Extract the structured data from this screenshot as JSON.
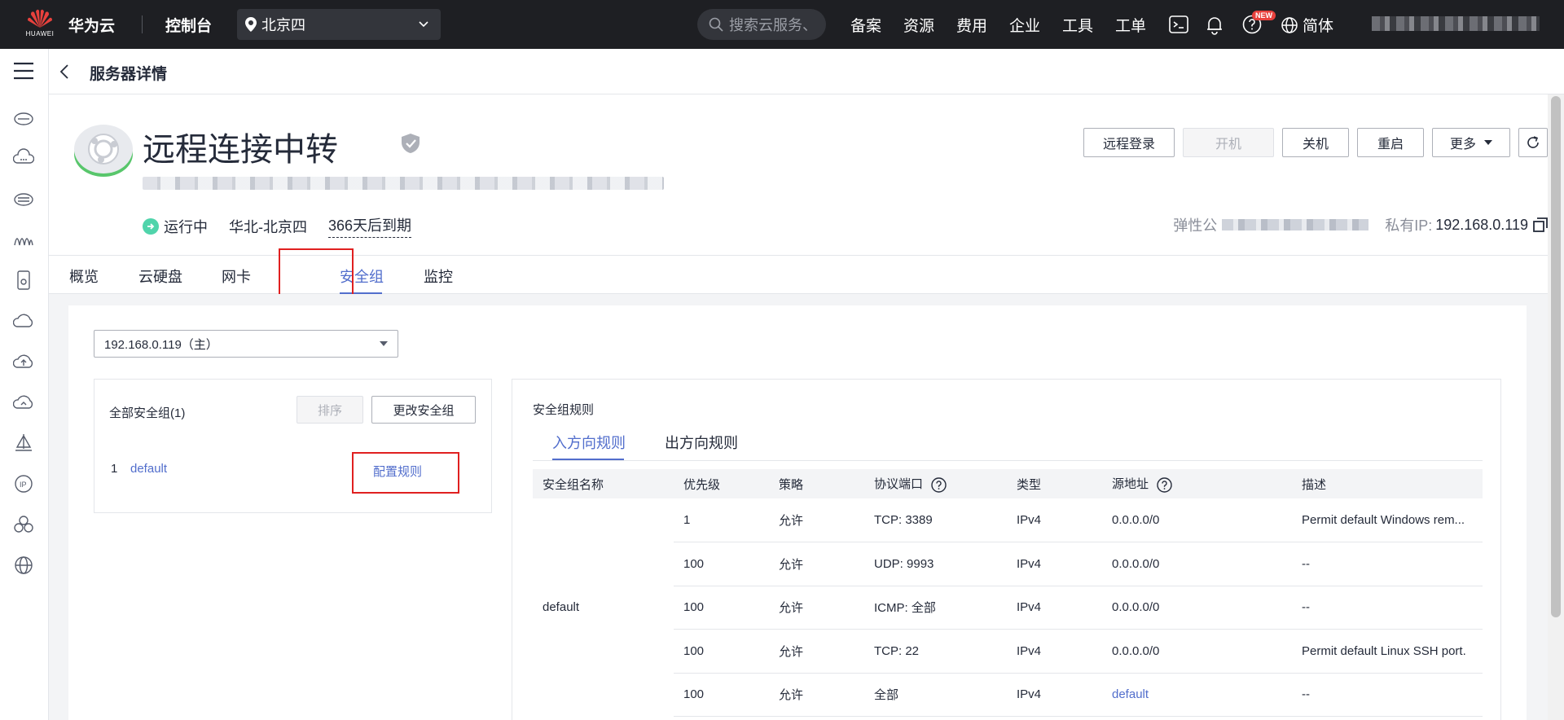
{
  "topbar": {
    "logo_text": "HUAWEI",
    "brand": "华为云",
    "console": "控制台",
    "region": "北京四",
    "search_placeholder": "搜索云服务、",
    "nav": [
      "备案",
      "资源",
      "费用",
      "企业",
      "工具",
      "工单"
    ],
    "new_badge": "NEW",
    "lang": "简体"
  },
  "header": {
    "title": "服务器详情"
  },
  "server": {
    "name": "远程连接中转",
    "status": "运行中",
    "region": "华北-北京四",
    "expiry": "366天后到期",
    "public_ip_label": "弹性公",
    "private_ip_label": "私有IP:",
    "private_ip": "192.168.0.119"
  },
  "actions": {
    "remote_login": "远程登录",
    "start": "开机",
    "stop": "关机",
    "restart": "重启",
    "more": "更多"
  },
  "tabs": [
    "概览",
    "云硬盘",
    "网卡",
    "安全组",
    "监控"
  ],
  "nic_select": "192.168.0.119（主）",
  "sg_list": {
    "title": "全部安全组(1)",
    "sort_label": "排序",
    "change_label": "更改安全组",
    "row_index": "1",
    "row_name": "default",
    "config_label": "配置规则"
  },
  "rules": {
    "title": "安全组规则",
    "tab_inbound": "入方向规则",
    "tab_outbound": "出方向规则",
    "columns": [
      "安全组名称",
      "优先级",
      "策略",
      "协议端口",
      "类型",
      "源地址",
      "描述"
    ],
    "group_name": "default",
    "rows": [
      {
        "priority": "1",
        "policy": "允许",
        "port": "TCP: 3389",
        "type": "IPv4",
        "source": "0.0.0.0/0",
        "desc": "Permit default Windows rem..."
      },
      {
        "priority": "100",
        "policy": "允许",
        "port": "UDP: 9993",
        "type": "IPv4",
        "source": "0.0.0.0/0",
        "desc": "--"
      },
      {
        "priority": "100",
        "policy": "允许",
        "port": "ICMP: 全部",
        "type": "IPv4",
        "source": "0.0.0.0/0",
        "desc": "--"
      },
      {
        "priority": "100",
        "policy": "允许",
        "port": "TCP: 22",
        "type": "IPv4",
        "source": "0.0.0.0/0",
        "desc": "Permit default Linux SSH port."
      },
      {
        "priority": "100",
        "policy": "允许",
        "port": "全部",
        "type": "IPv4",
        "source": "default",
        "desc": "--"
      }
    ]
  },
  "colors": {
    "accent": "#526ecc",
    "topbar_bg": "#1e1f23",
    "status_green": "#50d4ab",
    "highlight_red": "#e02020"
  }
}
